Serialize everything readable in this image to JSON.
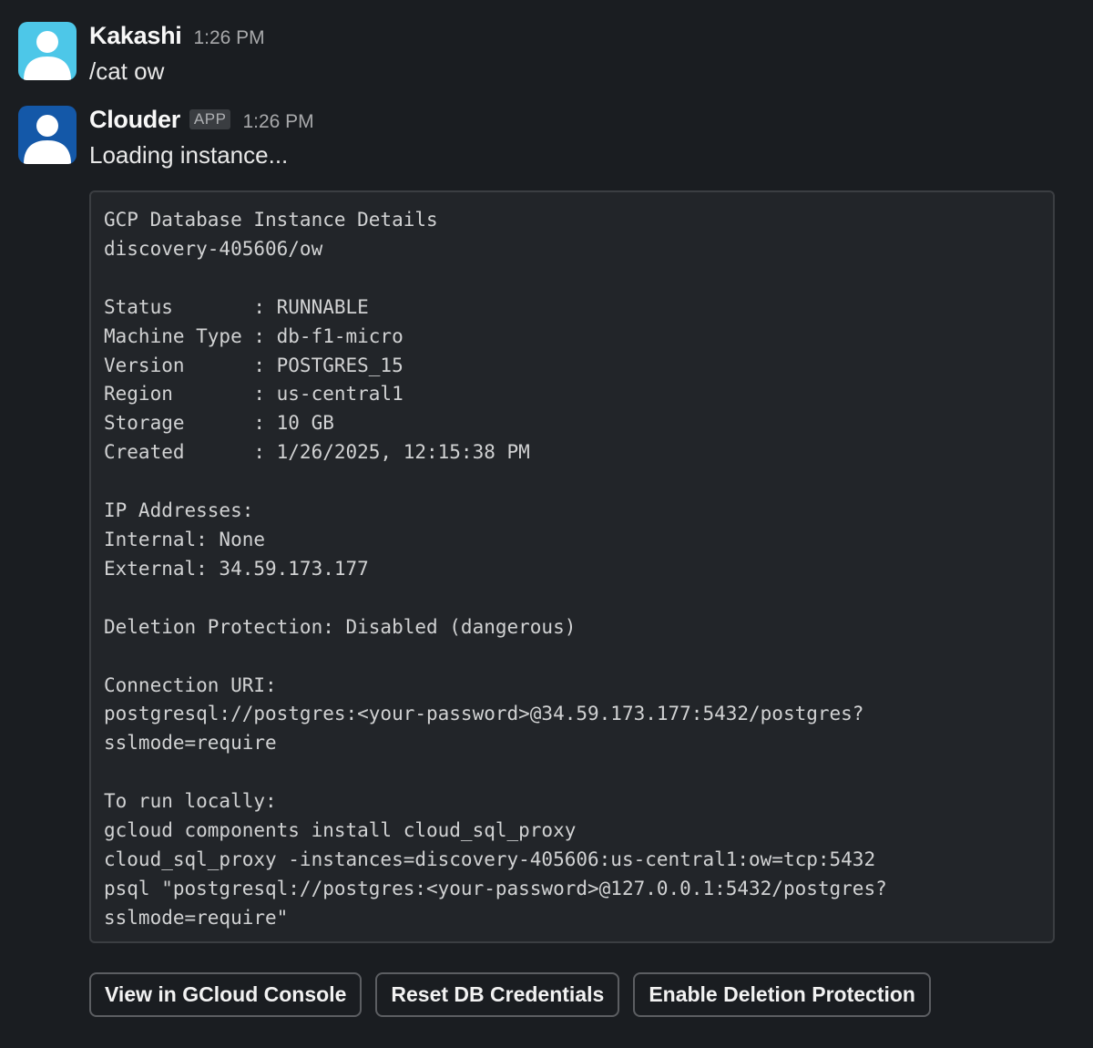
{
  "messages": [
    {
      "user": "Kakashi",
      "time": "1:26 PM",
      "text": "/cat ow",
      "avatar_color": "#4dc7e8",
      "avatar_icon": "person-icon"
    },
    {
      "user": "Clouder",
      "badge": "APP",
      "time": "1:26 PM",
      "text": "Loading instance...",
      "avatar_color": "#1458a8",
      "avatar_icon": "person-icon"
    }
  ],
  "code_block": {
    "lines": [
      "GCP Database Instance Details",
      "discovery-405606/ow",
      "",
      "Status       : RUNNABLE",
      "Machine Type : db-f1-micro",
      "Version      : POSTGRES_15",
      "Region       : us-central1",
      "Storage      : 10 GB",
      "Created      : 1/26/2025, 12:15:38 PM",
      "",
      "IP Addresses:",
      "Internal: None",
      "External: 34.59.173.177",
      "",
      "Deletion Protection: Disabled (dangerous)",
      "",
      "Connection URI:",
      "postgresql://postgres:<your-password>@34.59.173.177:5432/postgres?",
      "sslmode=require",
      "",
      "To run locally:",
      "gcloud components install cloud_sql_proxy",
      "cloud_sql_proxy -instances=discovery-405606:us-central1:ow=tcp:5432",
      "psql \"postgresql://postgres:<your-password>@127.0.0.1:5432/postgres?",
      "sslmode=require\""
    ]
  },
  "actions": {
    "view_console": "View in GCloud Console",
    "reset_credentials": "Reset DB Credentials",
    "enable_protection": "Enable Deletion Protection"
  }
}
